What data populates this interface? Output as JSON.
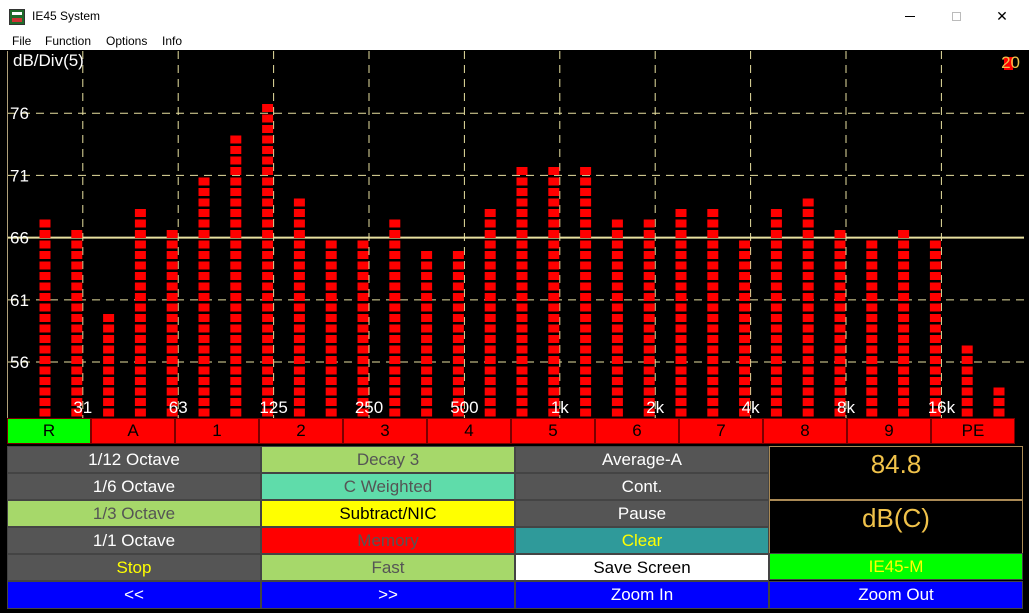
{
  "window": {
    "title": "IE45 System",
    "app_icon": "app-logo-icon",
    "controls": {
      "minimize": "minimize-icon",
      "maximize": "maximize-icon",
      "close_label": "✕"
    }
  },
  "menu": [
    "File",
    "Function",
    "Options",
    "Info"
  ],
  "chart_data": {
    "type": "bar",
    "title": "dB/Div(5)",
    "top_right_label": "20",
    "ylim": [
      51.5,
      81
    ],
    "y_ticks": [
      56,
      61,
      66,
      71,
      76
    ],
    "reference_level": 66,
    "x_tick_labels": [
      "31",
      "63",
      "125",
      "250",
      "500",
      "1k",
      "2k",
      "4k",
      "8k",
      "16k"
    ],
    "bar_color": "#ff0000",
    "values": [
      68,
      67,
      60,
      69,
      67,
      71,
      75,
      77,
      70,
      66,
      66,
      68,
      65,
      65,
      69,
      72,
      72,
      72,
      68,
      68,
      69,
      69,
      66,
      69,
      70,
      67,
      66,
      67,
      66,
      58,
      54
    ],
    "grid": true
  },
  "channels": [
    {
      "label": "R",
      "color": "#00ff00"
    },
    {
      "label": "A",
      "color": "#ff0000"
    },
    {
      "label": "1",
      "color": "#ff0000"
    },
    {
      "label": "2",
      "color": "#ff0000"
    },
    {
      "label": "3",
      "color": "#ff0000"
    },
    {
      "label": "4",
      "color": "#ff0000"
    },
    {
      "label": "5",
      "color": "#ff0000"
    },
    {
      "label": "6",
      "color": "#ff0000"
    },
    {
      "label": "7",
      "color": "#ff0000"
    },
    {
      "label": "8",
      "color": "#ff0000"
    },
    {
      "label": "9",
      "color": "#ff0000"
    },
    {
      "label": "PE",
      "color": "#ff0000"
    }
  ],
  "controls": {
    "col1": [
      {
        "label": "1/12 Octave",
        "bg": "#555555",
        "fg": "#ffffff"
      },
      {
        "label": "1/6 Octave",
        "bg": "#555555",
        "fg": "#ffffff"
      },
      {
        "label": "1/3 Octave",
        "bg": "#a6d86a",
        "fg": "#555555"
      },
      {
        "label": "1/1 Octave",
        "bg": "#555555",
        "fg": "#ffffff"
      },
      {
        "label": "Stop",
        "bg": "#555555",
        "fg": "#ffff00"
      }
    ],
    "col2": [
      {
        "label": "Decay 3",
        "bg": "#a6d86a",
        "fg": "#555555"
      },
      {
        "label": "C Weighted",
        "bg": "#5fdcaa",
        "fg": "#555555"
      },
      {
        "label": "Subtract/NIC",
        "bg": "#ffff00",
        "fg": "#000000"
      },
      {
        "label": "Memory",
        "bg": "#ff0000",
        "fg": "#555555"
      },
      {
        "label": "Fast",
        "bg": "#a6d86a",
        "fg": "#555555"
      }
    ],
    "col3": [
      {
        "label": "Average-A",
        "bg": "#555555",
        "fg": "#ffffff"
      },
      {
        "label": "Cont.",
        "bg": "#555555",
        "fg": "#ffffff"
      },
      {
        "label": "Pause",
        "bg": "#555555",
        "fg": "#ffffff"
      },
      {
        "label": "Clear",
        "bg": "#2f9a9a",
        "fg": "#ffff00"
      },
      {
        "label": "Save Screen",
        "bg": "#ffffff",
        "fg": "#000000"
      }
    ],
    "readout_value": "84.8",
    "readout_unit": "dB(C)",
    "model_button": {
      "label": "IE45-M",
      "bg": "#00ff00",
      "fg": "#ffff00"
    },
    "bottom": [
      {
        "label": "<<",
        "bg": "#0000ff",
        "fg": "#ffffff"
      },
      {
        "label": ">>",
        "bg": "#0000ff",
        "fg": "#ffffff"
      },
      {
        "label": "Zoom In",
        "bg": "#0000ff",
        "fg": "#ffffff"
      },
      {
        "label": "Zoom Out",
        "bg": "#0000ff",
        "fg": "#ffffff"
      }
    ]
  }
}
